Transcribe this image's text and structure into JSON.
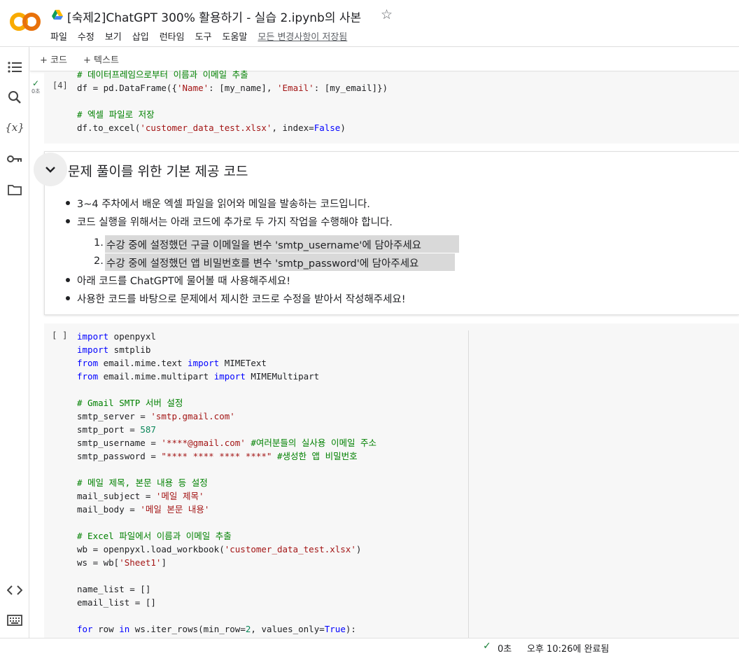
{
  "header": {
    "title": "[숙제2]ChatGPT 300% 활용하기 - 실습 2.ipynb의 사본",
    "logo_text": "CO",
    "menu": [
      "파일",
      "수정",
      "보기",
      "삽입",
      "런타임",
      "도구",
      "도움말"
    ],
    "saved_status": "모든 변경사항이 저장됨",
    "colors": {
      "logo": "#f9ab00",
      "drive": "#4285f4"
    }
  },
  "toolbar": {
    "add_code": "+ 코드",
    "add_text": "+ 텍스트"
  },
  "sidebar": {
    "icons": [
      "toc-icon",
      "search-icon",
      "variables-icon",
      "key-icon",
      "folder-icon",
      "code-snippets-icon",
      "terminal-icon"
    ],
    "variables_label": "{x}"
  },
  "cell1": {
    "exec_count": "[4]",
    "run_time": "0초",
    "lines": [
      [
        {
          "t": "cm",
          "v": "# 데이터프레임으로부터 이름과 이메일 추출"
        }
      ],
      [
        {
          "t": "",
          "v": "df = pd.DataFrame({"
        },
        {
          "t": "st",
          "v": "'Name'"
        },
        {
          "t": "",
          "v": ": [my_name], "
        },
        {
          "t": "st",
          "v": "'Email'"
        },
        {
          "t": "",
          "v": ": [my_email]})"
        }
      ],
      [],
      [
        {
          "t": "cm",
          "v": "# 엑셀 파일로 저장"
        }
      ],
      [
        {
          "t": "",
          "v": "df.to_excel("
        },
        {
          "t": "st",
          "v": "'customer_data_test.xlsx'"
        },
        {
          "t": "",
          "v": ", index="
        },
        {
          "t": "kw",
          "v": "False"
        },
        {
          "t": "",
          "v": ")"
        }
      ]
    ]
  },
  "textcell": {
    "title": "문제 풀이를 위한 기본 제공 코드",
    "bullet1": "3~4 주차에서 배운 엑셀 파일을 읽어와 메일을 발송하는 코드입니다.",
    "bullet2": "코드 실행을 위해서는 아래 코드에 추가로 두 가지 작업을 수행해야 합니다.",
    "ol1_num": "1.",
    "ol1": "수강 중에 설정했던 구글 이메일을 변수 'smtp_username'에 담아주세요",
    "ol2_num": "2.",
    "ol2": "수강 중에 설정했던 앱 비밀번호를 변수 'smtp_password'에 담아주세요",
    "bullet3": "아래 코드를 ChatGPT에 물어볼 때 사용해주세요!",
    "bullet4": "사용한 코드를 바탕으로 문제에서 제시한 코드로 수정을 받아서 작성해주세요!"
  },
  "cell2": {
    "exec_count": "[ ]",
    "lines": [
      [
        {
          "t": "kw",
          "v": "import"
        },
        {
          "t": "",
          "v": " openpyxl"
        }
      ],
      [
        {
          "t": "kw",
          "v": "import"
        },
        {
          "t": "",
          "v": " smtplib"
        }
      ],
      [
        {
          "t": "kw",
          "v": "from"
        },
        {
          "t": "",
          "v": " email.mime.text "
        },
        {
          "t": "kw",
          "v": "import"
        },
        {
          "t": "",
          "v": " MIMEText"
        }
      ],
      [
        {
          "t": "kw",
          "v": "from"
        },
        {
          "t": "",
          "v": " email.mime.multipart "
        },
        {
          "t": "kw",
          "v": "import"
        },
        {
          "t": "",
          "v": " MIMEMultipart"
        }
      ],
      [],
      [
        {
          "t": "cm",
          "v": "# Gmail SMTP 서버 설정"
        }
      ],
      [
        {
          "t": "",
          "v": "smtp_server = "
        },
        {
          "t": "st",
          "v": "'smtp.gmail.com'"
        }
      ],
      [
        {
          "t": "",
          "v": "smtp_port = "
        },
        {
          "t": "nm",
          "v": "587"
        }
      ],
      [
        {
          "t": "",
          "v": "smtp_username = "
        },
        {
          "t": "st",
          "v": "'****@gmail.com'"
        },
        {
          "t": "cm",
          "v": " #여러분들의 실사용 이메일 주소"
        }
      ],
      [
        {
          "t": "",
          "v": "smtp_password = "
        },
        {
          "t": "st",
          "v": "\"**** **** **** ****\""
        },
        {
          "t": "cm",
          "v": " #생성한 앱 비밀번호"
        }
      ],
      [],
      [
        {
          "t": "cm",
          "v": "# 메일 제목, 본문 내용 등 설정"
        }
      ],
      [
        {
          "t": "",
          "v": "mail_subject = "
        },
        {
          "t": "st",
          "v": "'메일 제목'"
        }
      ],
      [
        {
          "t": "",
          "v": "mail_body = "
        },
        {
          "t": "st",
          "v": "'메일 본문 내용'"
        }
      ],
      [],
      [
        {
          "t": "cm",
          "v": "# Excel 파일에서 이름과 이메일 추출"
        }
      ],
      [
        {
          "t": "",
          "v": "wb = openpyxl.load_workbook("
        },
        {
          "t": "st",
          "v": "'customer_data_test.xlsx'"
        },
        {
          "t": "",
          "v": ")"
        }
      ],
      [
        {
          "t": "",
          "v": "ws = wb["
        },
        {
          "t": "st",
          "v": "'Sheet1'"
        },
        {
          "t": "",
          "v": "]"
        }
      ],
      [],
      [
        {
          "t": "",
          "v": "name_list = []"
        }
      ],
      [
        {
          "t": "",
          "v": "email_list = []"
        }
      ],
      [],
      [
        {
          "t": "kw",
          "v": "for"
        },
        {
          "t": "",
          "v": " row "
        },
        {
          "t": "kw",
          "v": "in"
        },
        {
          "t": "",
          "v": " ws.iter_rows(min_row="
        },
        {
          "t": "nm",
          "v": "2"
        },
        {
          "t": "",
          "v": ", values_only="
        },
        {
          "t": "kw",
          "v": "True"
        },
        {
          "t": "",
          "v": "):"
        }
      ]
    ]
  },
  "statusbar": {
    "check": "✓",
    "time": "0초",
    "done": "오후 10:26에 완료됨"
  }
}
